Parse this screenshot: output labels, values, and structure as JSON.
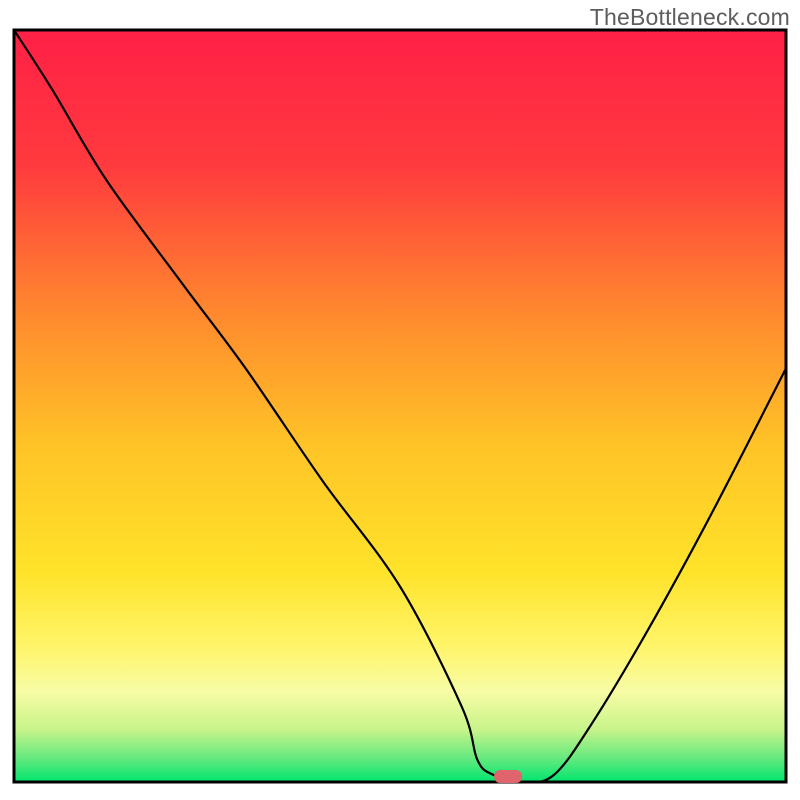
{
  "watermark": "TheBottleneck.com",
  "colors": {
    "top_red": "#ff2046",
    "mid_orange": "#ff9a2f",
    "yellow": "#ffe32a",
    "pale_green": "#c8f58a",
    "green": "#00e56f",
    "curve": "#000000",
    "marker": "#e0646d",
    "border": "#000000"
  },
  "chart_data": {
    "type": "line",
    "title": "",
    "xlabel": "",
    "ylabel": "",
    "xlim": [
      0,
      100
    ],
    "ylim": [
      0,
      100
    ],
    "x": [
      0,
      5,
      12,
      22,
      30,
      40,
      50,
      58,
      60,
      62,
      66,
      70,
      75,
      82,
      90,
      100
    ],
    "values": [
      100,
      92,
      80,
      66,
      55,
      40,
      26,
      10,
      3,
      1,
      0,
      1,
      8,
      20,
      35,
      55
    ],
    "marker_x": 64,
    "marker_y": 0
  }
}
